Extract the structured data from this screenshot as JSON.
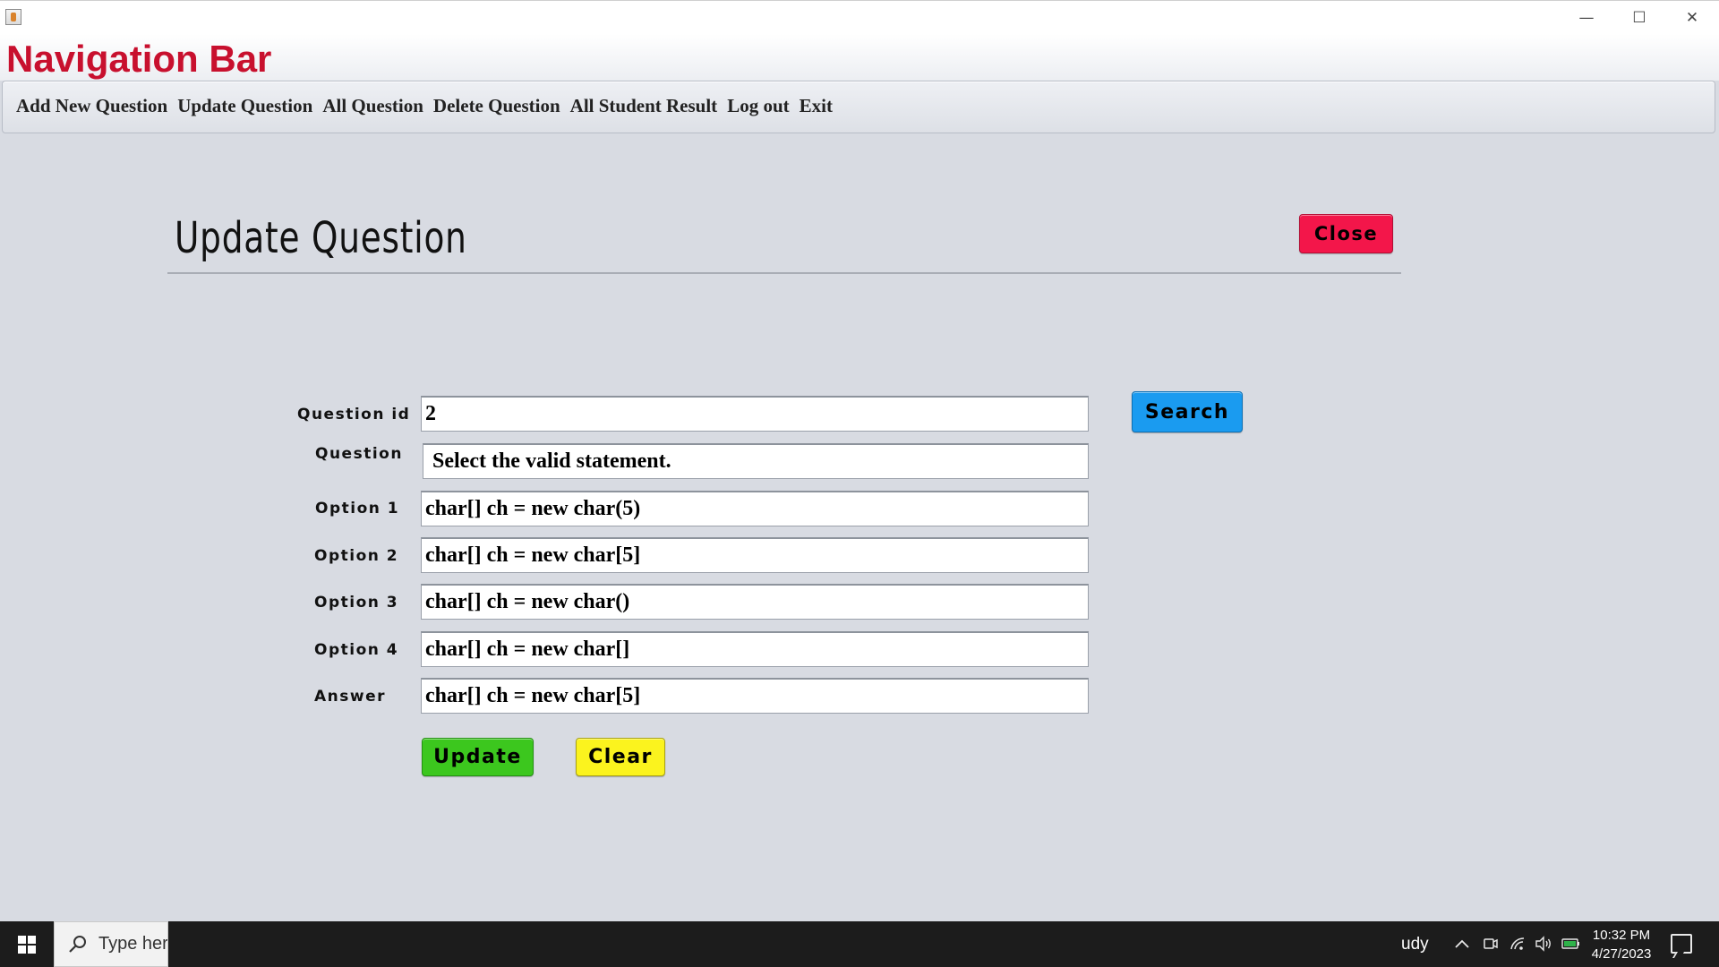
{
  "window": {
    "minimize_glyph": "—",
    "maximize_glyph": "☐",
    "close_glyph": "✕"
  },
  "header": {
    "title": "Navigation Bar"
  },
  "menu": {
    "items": [
      "Add New Question",
      "Update Question",
      "All Question",
      "Delete Question",
      "All Student Result",
      "Log out",
      "Exit"
    ]
  },
  "form": {
    "title": "Update Question",
    "close_label": "Close",
    "search_label": "Search",
    "update_label": "Update",
    "clear_label": "Clear",
    "fields": {
      "question_id": {
        "label": "Question id",
        "value": "2"
      },
      "question": {
        "label": "Question",
        "value": " Select the valid statement."
      },
      "option1": {
        "label": "Option 1",
        "value": "char[] ch = new char(5)"
      },
      "option2": {
        "label": "Option 2",
        "value": "char[] ch = new char[5]"
      },
      "option3": {
        "label": "Option 3",
        "value": "char[] ch = new char()"
      },
      "option4": {
        "label": "Option 4",
        "value": "char[] ch = new char[]"
      },
      "answer": {
        "label": "Answer",
        "value": "char[] ch = new char[5]"
      }
    }
  },
  "taskbar": {
    "search_placeholder": "Type here",
    "tray_partial_text": "udy",
    "time": "10:32 PM",
    "date": "4/27/2023"
  },
  "colors": {
    "nav_title": "#c8102e",
    "close_button": "#f3164a",
    "search_button": "#1a9bf0",
    "update_button": "#3cc71e",
    "clear_button": "#fbf31e",
    "background": "#d8dbe2"
  }
}
